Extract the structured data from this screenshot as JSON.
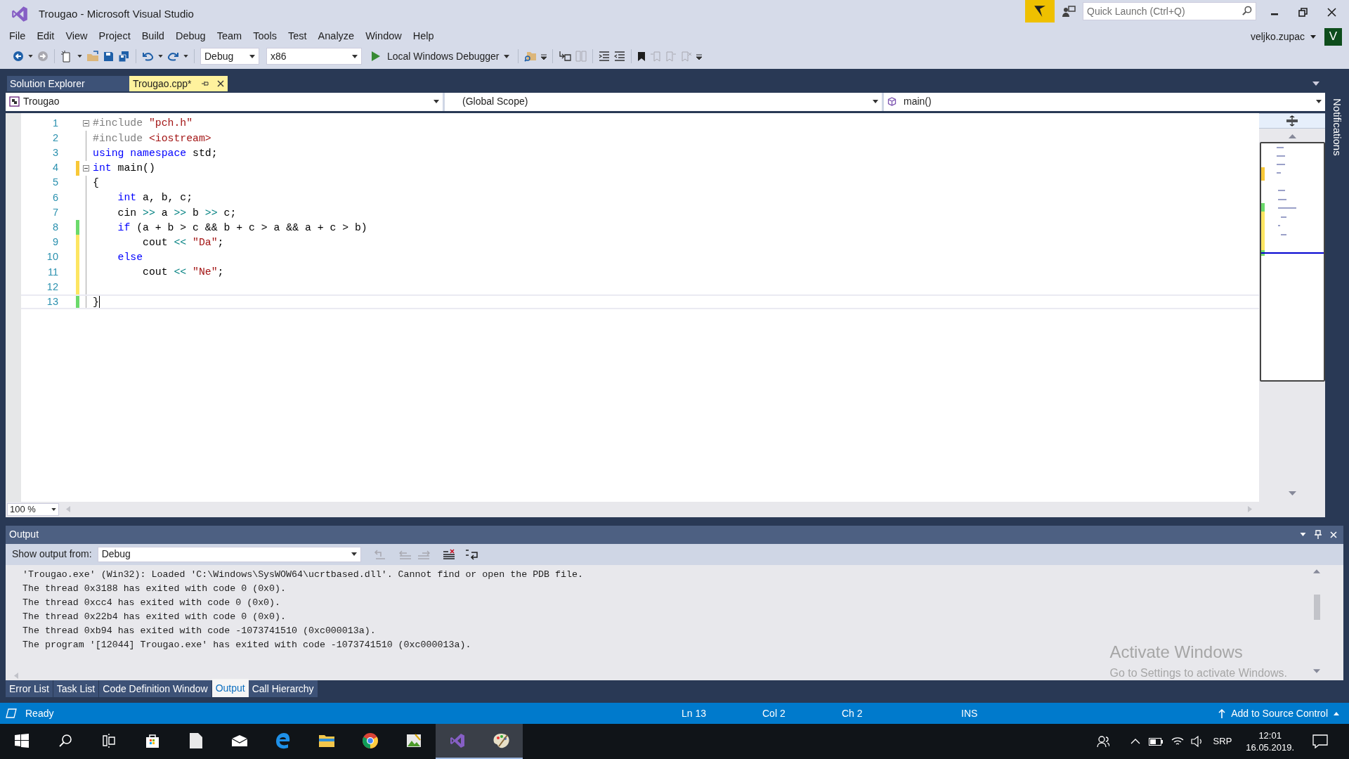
{
  "window": {
    "title": "Trougao - Microsoft Visual Studio"
  },
  "quick_launch": {
    "placeholder": "Quick Launch (Ctrl+Q)"
  },
  "account": {
    "user": "veljko.zupac",
    "initial": "V"
  },
  "menu": [
    "File",
    "Edit",
    "View",
    "Project",
    "Build",
    "Debug",
    "Team",
    "Tools",
    "Test",
    "Analyze",
    "Window",
    "Help"
  ],
  "toolbar": {
    "configuration": "Debug",
    "platform": "x86",
    "debugger": "Local Windows Debugger"
  },
  "doc_tabs": [
    {
      "label": "Solution Explorer",
      "selected": false
    },
    {
      "label": "Trougao.cpp*",
      "selected": true
    }
  ],
  "nav_bar": {
    "project": "Trougao",
    "scope": "(Global Scope)",
    "member": "main()"
  },
  "editor": {
    "zoom": "100 %",
    "lines": [
      {
        "number": "1",
        "fold": true,
        "current": false,
        "tokens": [
          {
            "text": "#include ",
            "kind": "preprocessor"
          },
          {
            "text": "\"pch.h\"",
            "kind": "string"
          }
        ]
      },
      {
        "number": "2",
        "fold": false,
        "current": false,
        "tokens": [
          {
            "text": "#include ",
            "kind": "preprocessor"
          },
          {
            "text": "<iostream>",
            "kind": "string"
          }
        ]
      },
      {
        "number": "3",
        "fold": false,
        "current": false,
        "tokens": [
          {
            "text": "using namespace",
            "kind": "keyword"
          },
          {
            "text": " std;",
            "kind": "plain"
          }
        ]
      },
      {
        "number": "4",
        "color": "#f8c837",
        "fold": true,
        "current": false,
        "tokens": [
          {
            "text": "int",
            "kind": "keyword"
          },
          {
            "text": " main()",
            "kind": "plain"
          }
        ]
      },
      {
        "number": "5",
        "fold": false,
        "current": false,
        "tokens": [
          {
            "text": "{",
            "kind": "plain"
          }
        ]
      },
      {
        "number": "6",
        "fold": false,
        "current": false,
        "tokens": [
          {
            "text": "    int",
            "kind": "keyword"
          },
          {
            "text": " a, b, c;",
            "kind": "plain"
          }
        ]
      },
      {
        "number": "7",
        "fold": false,
        "current": false,
        "tokens": [
          {
            "text": "    cin ",
            "kind": "plain"
          },
          {
            "text": ">>",
            "kind": "operator"
          },
          {
            "text": " a ",
            "kind": "plain"
          },
          {
            "text": ">>",
            "kind": "operator"
          },
          {
            "text": " b ",
            "kind": "plain"
          },
          {
            "text": ">>",
            "kind": "operator"
          },
          {
            "text": " c;",
            "kind": "plain"
          }
        ]
      },
      {
        "number": "8",
        "color": "#6bda6b",
        "fold": false,
        "current": false,
        "tokens": [
          {
            "text": "    if",
            "kind": "keyword"
          },
          {
            "text": " (a + b > c && b + c > a && a + c > b)",
            "kind": "plain"
          }
        ]
      },
      {
        "number": "9",
        "color": "#fde562",
        "fold": false,
        "current": false,
        "tokens": [
          {
            "text": "        cout ",
            "kind": "plain"
          },
          {
            "text": "<< ",
            "kind": "operator"
          },
          {
            "text": "\"Da\"",
            "kind": "string"
          },
          {
            "text": ";",
            "kind": "plain"
          }
        ]
      },
      {
        "number": "10",
        "color": "#fde562",
        "fold": false,
        "current": false,
        "tokens": [
          {
            "text": "    else",
            "kind": "keyword"
          }
        ]
      },
      {
        "number": "11",
        "color": "#fde562",
        "fold": false,
        "current": false,
        "tokens": [
          {
            "text": "        cout ",
            "kind": "plain"
          },
          {
            "text": "<< ",
            "kind": "operator"
          },
          {
            "text": "\"Ne\"",
            "kind": "string"
          },
          {
            "text": ";",
            "kind": "plain"
          }
        ]
      },
      {
        "number": "12",
        "color": "#fde562",
        "fold": false,
        "current": false
      },
      {
        "number": "13",
        "color": "#6bda6b",
        "fold": false,
        "current": true,
        "tokens": [
          {
            "text": "}",
            "kind": "plain"
          }
        ]
      }
    ]
  },
  "side_tab": "Notifications",
  "output": {
    "title": "Output",
    "source_label": "Show output from:",
    "source": "Debug",
    "lines": [
      "'Trougao.exe' (Win32): Loaded 'C:\\Windows\\SysWOW64\\ucrtbased.dll'. Cannot find or open the PDB file.",
      "The thread 0x3188 has exited with code 0 (0x0).",
      "The thread 0xcc4 has exited with code 0 (0x0).",
      "The thread 0x22b4 has exited with code 0 (0x0).",
      "The thread 0xb94 has exited with code -1073741510 (0xc000013a).",
      "The program '[12044] Trougao.exe' has exited with code -1073741510 (0xc000013a)."
    ]
  },
  "bottom_tabs": [
    {
      "label": "Error List",
      "selected": false
    },
    {
      "label": "Task List",
      "selected": false
    },
    {
      "label": "Code Definition Window",
      "selected": false
    },
    {
      "label": "Output",
      "selected": true
    },
    {
      "label": "Call Hierarchy",
      "selected": false
    }
  ],
  "activation_notice": {
    "title": "Activate Windows",
    "text": "Go to Settings to activate Windows."
  },
  "status_bar": {
    "state": "Ready",
    "line": "Ln 13",
    "col": "Col 2",
    "ch": "Ch 2",
    "mode": "INS",
    "source_control": "Add to Source Control"
  },
  "tray": {
    "language": "SRP",
    "time": "12:01",
    "date": "16.05.2019."
  }
}
